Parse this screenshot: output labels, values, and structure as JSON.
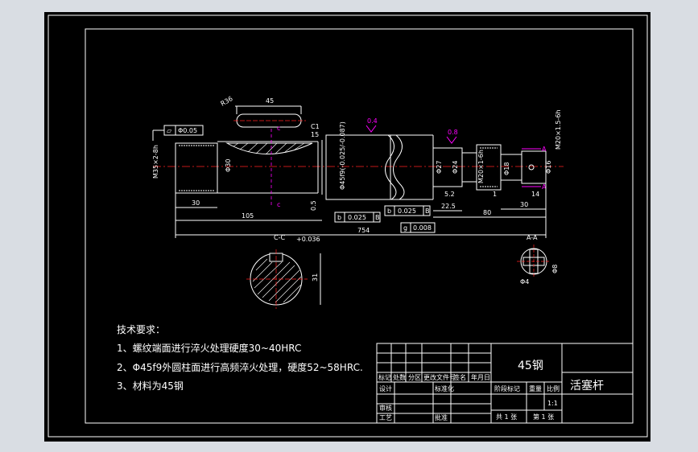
{
  "drawing": {
    "colors": {
      "background": "#000000",
      "frame": "#ffffff",
      "centerline": "#ff2020",
      "symbol": "#ff00ff",
      "text": "#ffffff"
    },
    "dimensions": {
      "keyway_length": "45",
      "keyway_r": "R36",
      "tol_flat": "Φ0.05",
      "ct": "C1",
      "d15": "15",
      "m_thread": "M35×2-8h",
      "d_shaft": "Φ30",
      "h30": "30",
      "l105": "105",
      "l754": "754",
      "l5": "0.5",
      "major_dia": "Φ45f9(-0.025/-0.087)",
      "tol_b1": "b",
      "tol_b1_val": "0.025",
      "tol_b1_ref": "B",
      "tol_b2": "b",
      "tol_b2_val": "0.025",
      "tol_b2_ref": "B",
      "tol_circ": "g",
      "tol_circ_val": "0.008",
      "d27": "Φ27",
      "d24": "Φ24",
      "l52": "5.2",
      "l22": "22.5",
      "l80": "80",
      "d_thread2": "M20×1-6h",
      "l30b": "30",
      "l1": "1",
      "l14": "14",
      "d18": "Φ18",
      "d16": "Φ16",
      "thread_right": "M20×1.5-6h",
      "roughness_a": "0.4",
      "roughness_b": "0.8",
      "section_label": "C-C",
      "section_tol": "+0.036",
      "section_dim": "31",
      "aa_label": "A-A",
      "aa_dim1": "Φ4",
      "aa_dim2": "Φ8",
      "cut_label": "c"
    },
    "tech_requirements": {
      "title": "技术要求：",
      "items": [
        "1、螺纹端面进行淬火处理硬度30~40HRC",
        "2、Φ45f9外圆柱面进行高频淬火处理，硬度52~58HRC.",
        "3、材料为45钢"
      ]
    },
    "title_block": {
      "material": "45钢",
      "part_name": "活塞杆",
      "headers": [
        "标记",
        "处数",
        "分区",
        "更改文件号",
        "签名",
        "年月日"
      ],
      "design": "设计",
      "standardize": "标准化",
      "review": "审核",
      "process": "工艺",
      "approve": "批准",
      "stage_mark": "阶段标记",
      "weight": "重量",
      "ratio": "比例",
      "ratio_val": "1:1",
      "total_sheets": "共 1 张",
      "sheet_no": "第 1 张"
    }
  }
}
